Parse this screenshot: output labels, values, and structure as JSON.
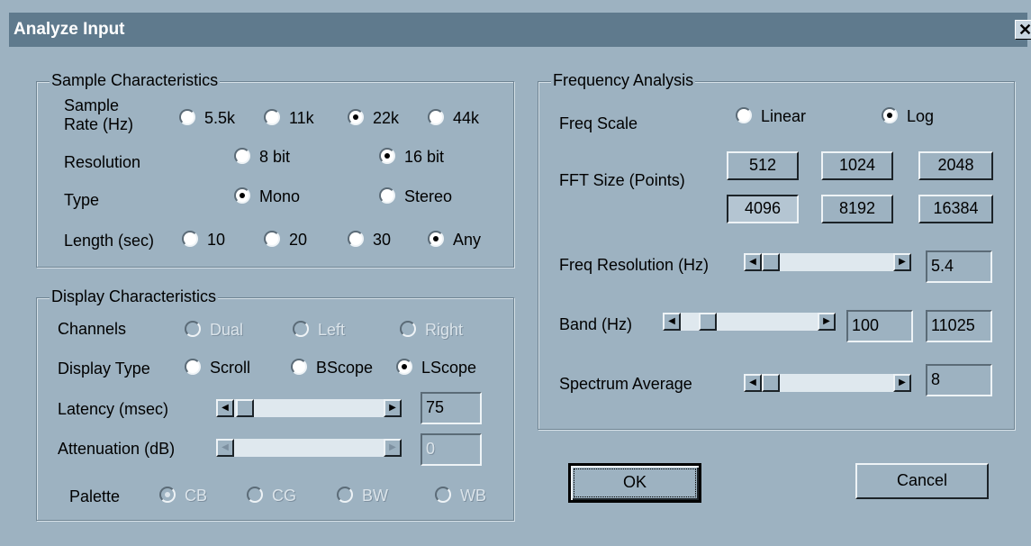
{
  "window": {
    "title": "Analyze Input",
    "close_glyph": "✕"
  },
  "sample": {
    "legend": "Sample Characteristics",
    "rate_label_line1": "Sample",
    "rate_label_line2": "Rate (Hz)",
    "rates": [
      {
        "label": "5.5k",
        "checked": false
      },
      {
        "label": "11k",
        "checked": false
      },
      {
        "label": "22k",
        "checked": true
      },
      {
        "label": "44k",
        "checked": false
      }
    ],
    "resolution_label": "Resolution",
    "resolutions": [
      {
        "label": "8 bit",
        "checked": false
      },
      {
        "label": "16 bit",
        "checked": true
      }
    ],
    "type_label": "Type",
    "types": [
      {
        "label": "Mono",
        "checked": true
      },
      {
        "label": "Stereo",
        "checked": false
      }
    ],
    "length_label": "Length (sec)",
    "lengths": [
      {
        "label": "10",
        "checked": false
      },
      {
        "label": "20",
        "checked": false
      },
      {
        "label": "30",
        "checked": false
      },
      {
        "label": "Any",
        "checked": true
      }
    ]
  },
  "display": {
    "legend": "Display Characteristics",
    "channels_label": "Channels",
    "channels": [
      {
        "label": "Dual",
        "checked": false
      },
      {
        "label": "Left",
        "checked": false
      },
      {
        "label": "Right",
        "checked": false
      }
    ],
    "display_type_label": "Display Type",
    "display_types": [
      {
        "label": "Scroll",
        "checked": false
      },
      {
        "label": "BScope",
        "checked": false
      },
      {
        "label": "LScope",
        "checked": true
      }
    ],
    "latency_label": "Latency (msec)",
    "latency_value": "75",
    "attenuation_label": "Attenuation (dB)",
    "attenuation_value": "0",
    "palette_label": "Palette",
    "palettes": [
      {
        "label": "CB",
        "checked": true
      },
      {
        "label": "CG",
        "checked": false
      },
      {
        "label": "BW",
        "checked": false
      },
      {
        "label": "WB",
        "checked": false
      }
    ]
  },
  "frequency": {
    "legend": "Frequency Analysis",
    "scale_label": "Freq Scale",
    "scales": [
      {
        "label": "Linear",
        "checked": false
      },
      {
        "label": "Log",
        "checked": true
      }
    ],
    "fft_label": "FFT Size (Points)",
    "fft_sizes": [
      "512",
      "1024",
      "2048",
      "4096",
      "8192",
      "16384"
    ],
    "fft_selected": "4096",
    "resolution_label": "Freq Resolution (Hz)",
    "resolution_value": "5.4",
    "band_label": "Band (Hz)",
    "band_low": "100",
    "band_high": "11025",
    "average_label": "Spectrum Average",
    "average_value": "8"
  },
  "buttons": {
    "ok": "OK",
    "cancel": "Cancel"
  },
  "icons": {
    "arrow_left": "◀",
    "arrow_right": "▶"
  }
}
